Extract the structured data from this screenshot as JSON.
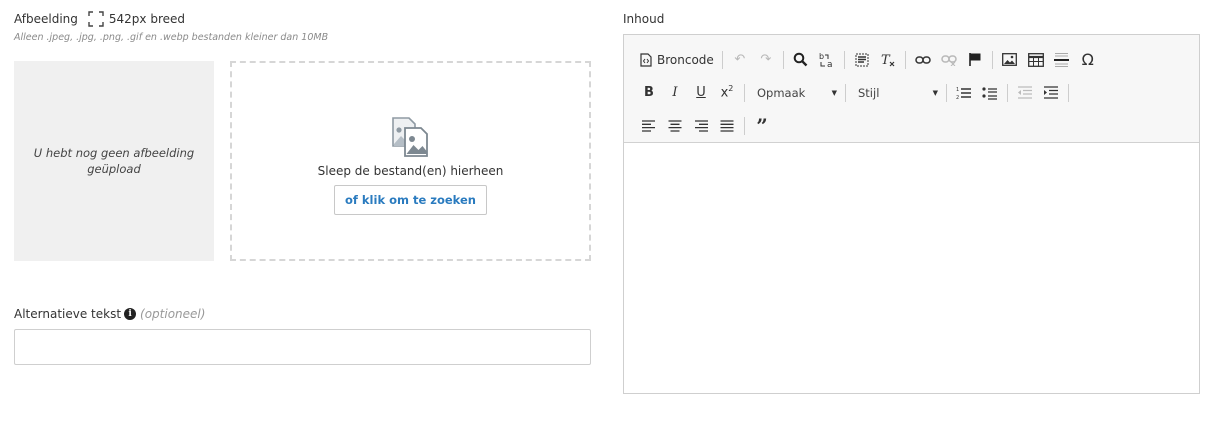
{
  "image_field": {
    "label": "Afbeelding",
    "size_hint": "542px breed",
    "expand_icon": "expand-icon",
    "file_hint": "Alleen .jpeg, .jpg, .png, .gif en .webp bestanden kleiner dan 10MB",
    "no_image_text": "U hebt nog geen afbeelding geüpload",
    "dropzone": {
      "icon": "images-icon",
      "text": "Sleep de bestand(en) hierheen",
      "button_label": "of klik om te zoeken"
    }
  },
  "alt_text": {
    "label": "Alternatieve tekst",
    "info_icon": "info-icon",
    "optional": "(optioneel)",
    "value": "",
    "placeholder": ""
  },
  "content": {
    "label": "Inhoud",
    "toolbar": {
      "source_label": "Broncode",
      "format_label": "Opmaak",
      "style_label": "Stijl"
    }
  },
  "colors": {
    "accent": "#2a7bbf",
    "toolbar_bg": "#f7f7f7",
    "placeholder_bg": "#f0f0f0"
  }
}
